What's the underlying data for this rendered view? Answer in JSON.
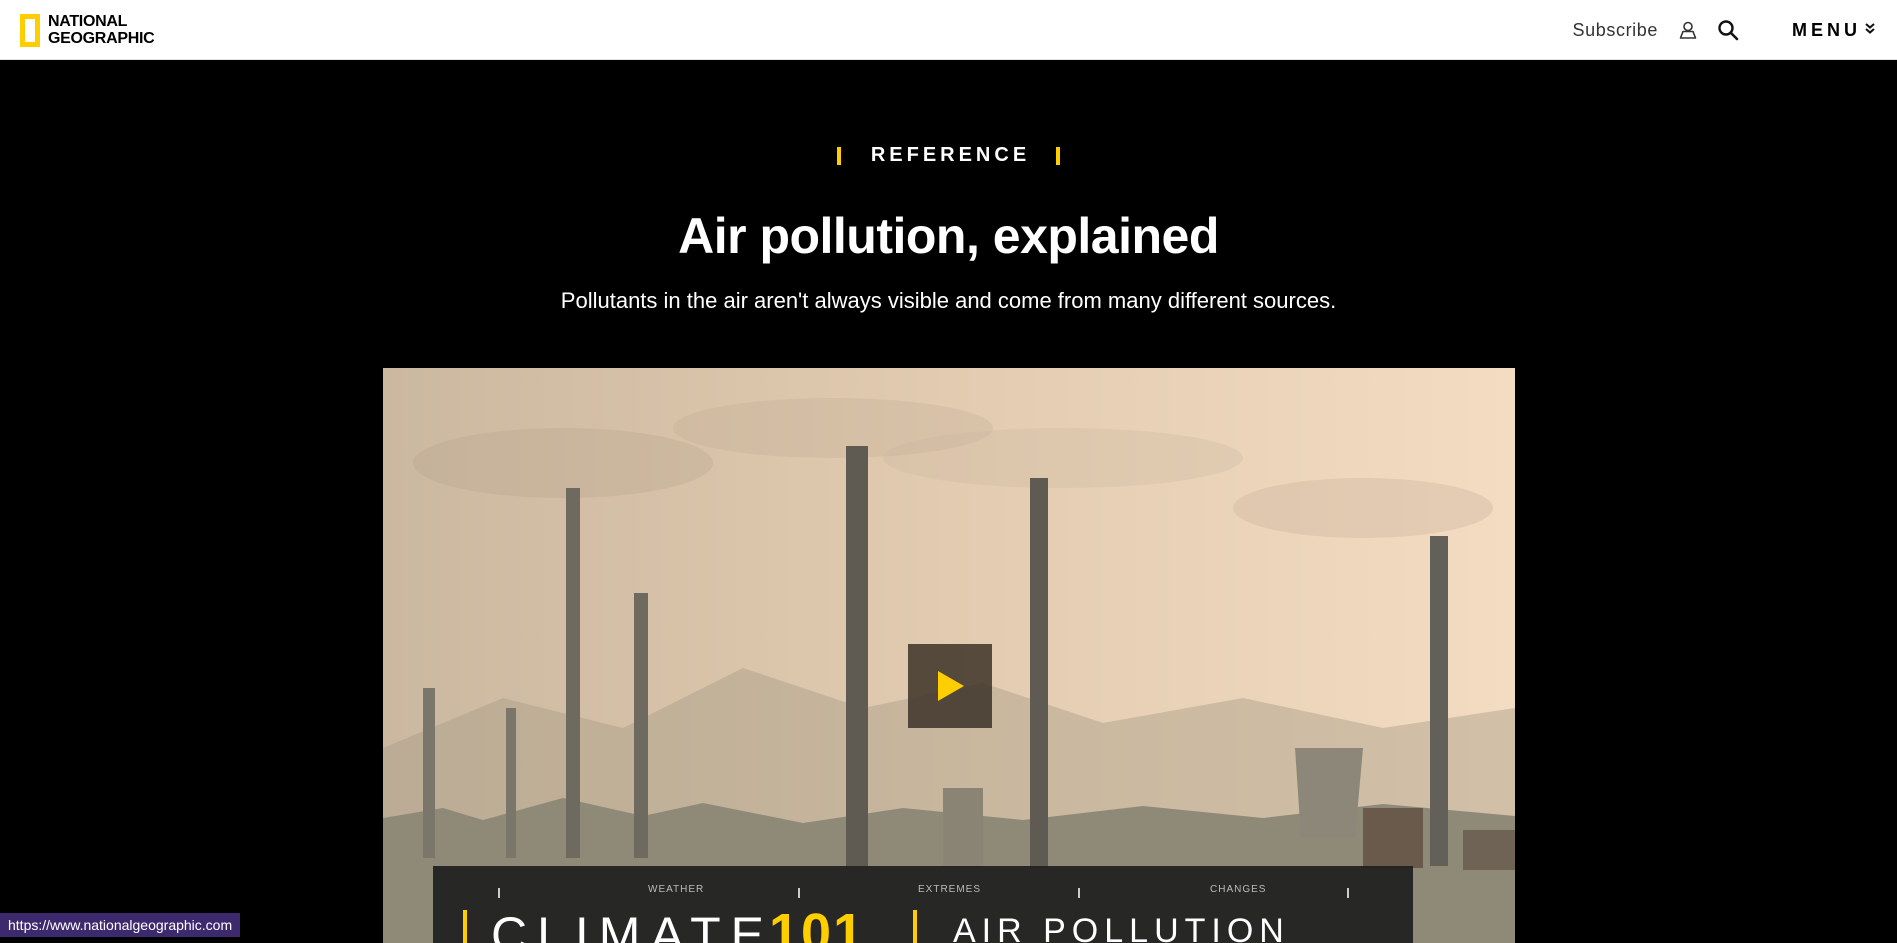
{
  "header": {
    "logo_line1": "NATIONAL",
    "logo_line2": "GEOGRAPHIC",
    "subscribe_label": "Subscribe",
    "menu_label": "MENU",
    "icons": [
      "user-icon",
      "search-icon",
      "chevron-down-icon"
    ],
    "brand_color": "#FFCE00"
  },
  "hero": {
    "kicker": "REFERENCE",
    "title": "Air pollution, explained",
    "subtitle": "Pollutants in the air aren't always visible and come from many different sources."
  },
  "video": {
    "banner": {
      "labels": [
        "WEATHER",
        "EXTREMES",
        "CHANGES"
      ],
      "word": "CLIMATE",
      "number": "101",
      "topic": "AIR POLLUTION"
    },
    "play_icon": "play-icon"
  },
  "status_bar": {
    "url": "https://www.nationalgeographic.com"
  }
}
